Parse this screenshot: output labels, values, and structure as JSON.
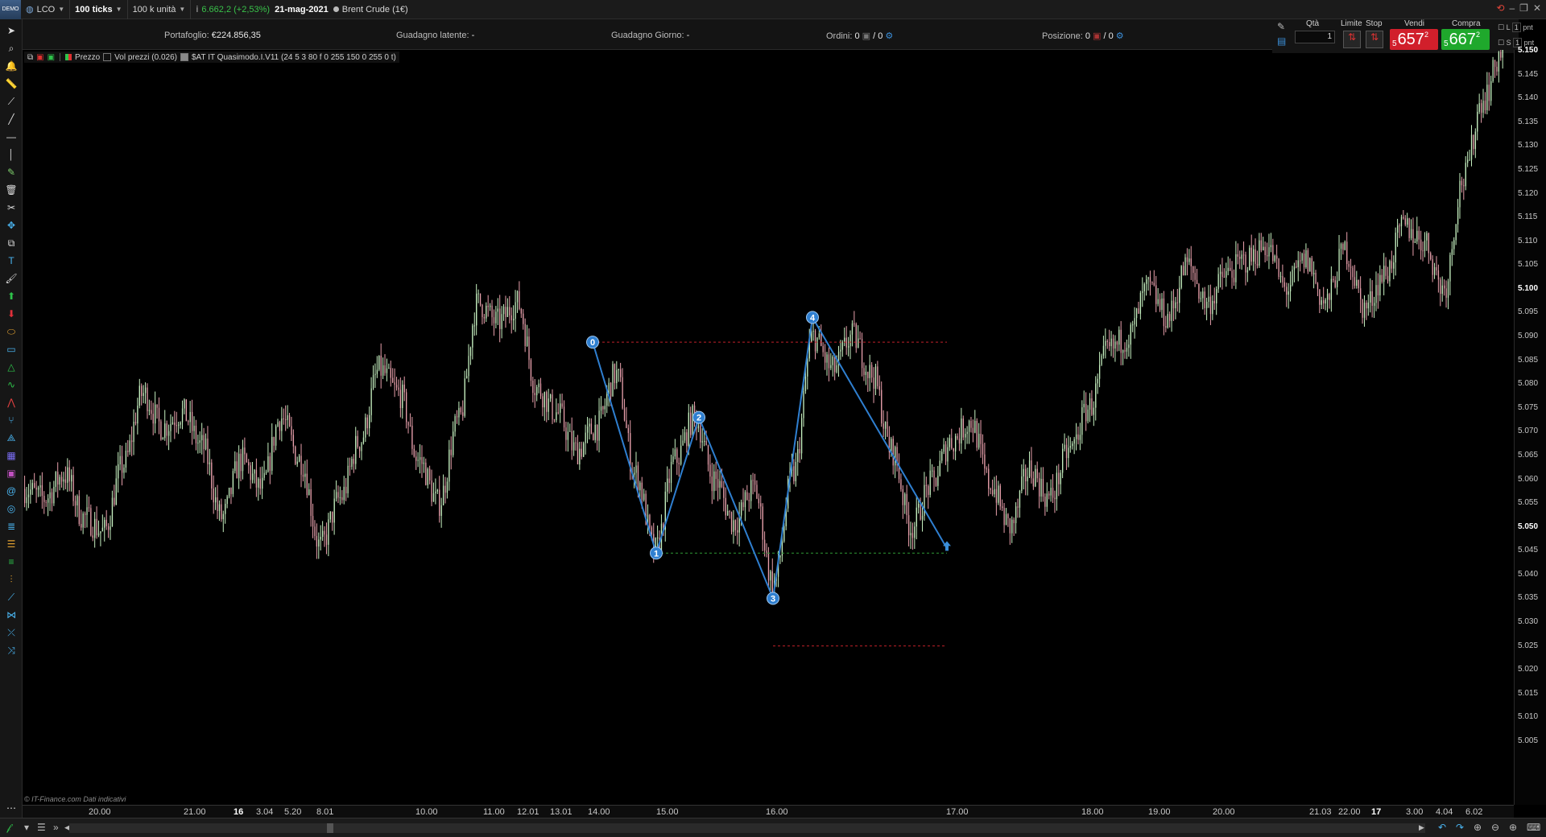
{
  "topbar": {
    "logo_text": "DEMO",
    "instrument": "LCO",
    "tick_setting": "100 ticks",
    "volume_setting": "100 k unità",
    "pnl": "6.662,2 (+2,53%)",
    "date": "21-mag-2021",
    "instrument_name": "Brent Crude (1€)"
  },
  "portfolio": {
    "portafoglio_label": "Portafoglio:",
    "portafoglio_value": "€224.856,35",
    "latente_label": "Guadagno latente:",
    "latente_value": "-",
    "giorno_label": "Guadagno Giorno:",
    "giorno_value": "-",
    "ordini_label": "Ordini:",
    "ordini_value": "0",
    "ordini_slash": "/ 0",
    "posizione_label": "Posizione:",
    "posizione_value": "0",
    "posizione_slash": "/ 0"
  },
  "order_panel": {
    "qty_label": "Qtà",
    "qty_value": "1",
    "limit_label": "Limite",
    "stop_label": "Stop",
    "sell_label": "Vendi",
    "sell_prefix": "5",
    "sell_big": "657",
    "sell_sup": "2",
    "buy_label": "Compra",
    "buy_prefix": "5",
    "buy_big": "667",
    "buy_sup": "2",
    "l_label": "L",
    "s_label": "S",
    "pnt_label": "pnt"
  },
  "legend": {
    "price": "Prezzo",
    "volume": "Vol prezzi (0.026)",
    "indicator": "$AT IT Quasimodo.I.V11 (24 5 3 80 f 0 255 150 0 255 0 t)"
  },
  "credit": "© IT-Finance.com  Dati indicativi",
  "price_axis": [
    "5.150",
    "5.145",
    "5.140",
    "5.135",
    "5.130",
    "5.125",
    "5.120",
    "5.115",
    "5.110",
    "5.105",
    "5.100",
    "5.095",
    "5.090",
    "5.085",
    "5.080",
    "5.075",
    "5.070",
    "5.065",
    "5.060",
    "5.055",
    "5.050",
    "5.045",
    "5.040",
    "5.035",
    "5.030",
    "5.025",
    "5.020",
    "5.015",
    "5.010",
    "5.005"
  ],
  "time_axis": [
    {
      "label": "20.00",
      "bold": false
    },
    {
      "label": "21.00",
      "bold": false
    },
    {
      "label": "16",
      "bold": true
    },
    {
      "label": "3.04",
      "bold": false
    },
    {
      "label": "5.20",
      "bold": false
    },
    {
      "label": "8.01",
      "bold": false
    },
    {
      "label": "10.00",
      "bold": false
    },
    {
      "label": "11.00",
      "bold": false
    },
    {
      "label": "12.01",
      "bold": false
    },
    {
      "label": "13.01",
      "bold": false
    },
    {
      "label": "14.00",
      "bold": false
    },
    {
      "label": "15.00",
      "bold": false
    },
    {
      "label": "16.00",
      "bold": false
    },
    {
      "label": "17.00",
      "bold": false
    },
    {
      "label": "18.00",
      "bold": false
    },
    {
      "label": "19.00",
      "bold": false
    },
    {
      "label": "20.00",
      "bold": false
    },
    {
      "label": "21.03",
      "bold": false
    },
    {
      "label": "22.00",
      "bold": false
    },
    {
      "label": "17",
      "bold": true
    },
    {
      "label": "3.00",
      "bold": false
    },
    {
      "label": "4.04",
      "bold": false
    },
    {
      "label": "6.02",
      "bold": false
    }
  ],
  "pattern_points": [
    {
      "label": "0",
      "price": 5.0888
    },
    {
      "label": "1",
      "price": 5.0445
    },
    {
      "label": "2",
      "price": 5.073
    },
    {
      "label": "3",
      "price": 5.035
    },
    {
      "label": "4",
      "price": 5.094
    }
  ],
  "price_anchors": [
    5.058,
    5.056,
    5.061,
    5.052,
    5.049,
    5.063,
    5.078,
    5.071,
    5.074,
    5.067,
    5.052,
    5.064,
    5.058,
    5.073,
    5.064,
    5.046,
    5.056,
    5.068,
    5.083,
    5.078,
    5.064,
    5.055,
    5.072,
    5.097,
    5.093,
    5.097,
    5.079,
    5.074,
    5.066,
    5.071,
    5.082,
    5.061,
    5.045,
    5.064,
    5.073,
    5.06,
    5.051,
    5.058,
    5.038,
    5.061,
    5.09,
    5.083,
    5.09,
    5.082,
    5.066,
    5.05,
    5.059,
    5.068,
    5.072,
    5.059,
    5.05,
    5.062,
    5.056,
    5.066,
    5.075,
    5.087,
    5.09,
    5.1,
    5.094,
    5.105,
    5.097,
    5.103,
    5.106,
    5.109,
    5.1,
    5.106,
    5.097,
    5.108,
    5.096,
    5.103,
    5.113,
    5.11,
    5.1,
    5.123,
    5.14,
    5.15
  ],
  "colors": {
    "pattern_line": "#2f7fd0",
    "bull_candle": "#c6f0c0",
    "bear_candle": "#e8a0ac",
    "dashed_red": "#c0202a",
    "dashed_green": "#2f9a35",
    "sell": "#d11f2b",
    "buy": "#1fa82c"
  }
}
